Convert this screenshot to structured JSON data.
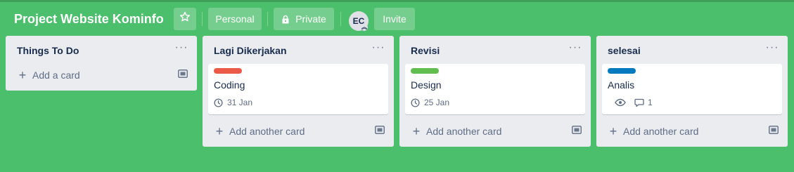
{
  "board": {
    "title": "Project Website Kominfo",
    "star_icon": "star-icon",
    "visibility_personal": "Personal",
    "visibility_private": "Private",
    "lock_icon": "lock-icon",
    "avatar_initials": "EC",
    "invite_label": "Invite",
    "background_color": "#4bbf6b"
  },
  "lists": [
    {
      "title": "Things To Do",
      "cards": [],
      "add_card_label": "Add a card"
    },
    {
      "title": "Lagi Dikerjakan",
      "cards": [
        {
          "label_color": "#eb5a46",
          "title": "Coding",
          "due": "31 Jan"
        }
      ],
      "add_card_label": "Add another card"
    },
    {
      "title": "Revisi",
      "cards": [
        {
          "label_color": "#61bd4f",
          "title": "Design",
          "due": "25 Jan"
        }
      ],
      "add_card_label": "Add another card"
    },
    {
      "title": "selesai",
      "cards": [
        {
          "label_color": "#0079bf",
          "title": "Analis",
          "comments": "1"
        }
      ],
      "add_card_label": "Add another card"
    }
  ]
}
